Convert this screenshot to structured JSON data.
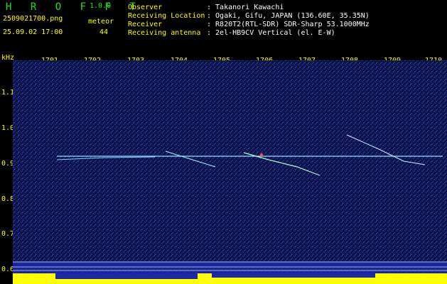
{
  "app": {
    "name": "H R O F F T",
    "version": "1.0.0"
  },
  "file": {
    "name": "2509021700.png",
    "datetime": "25.09.02 17:00"
  },
  "meteor": {
    "label": "meteor",
    "count": "44"
  },
  "info": [
    {
      "label": "Observer",
      "value": ": Takanori Kawachi"
    },
    {
      "label": "Receiving Location",
      "value": ": Ogaki, Gifu, JAPAN (136.60E, 35.35N)"
    },
    {
      "label": "Receiver",
      "value": ": R820T2(RTL-SDR) SDR-Sharp 53.1000MHz"
    },
    {
      "label": "Receiving antenna",
      "value": ": 2el-HB9CV Vertical (el. E-W)"
    }
  ],
  "axis": {
    "unit": "kHz",
    "x_ticks": [
      "1701",
      "1702",
      "1703",
      "1704",
      "1705",
      "1706",
      "1707",
      "1708",
      "1709",
      "1710"
    ],
    "y_ticks": [
      "1.1",
      "1.0",
      "0.9",
      "0.8",
      "0.7",
      "0.6"
    ]
  },
  "colors": {
    "background": "#000000",
    "label": "#ffff00",
    "title": "#22dd22",
    "noise": "#1a2a9a",
    "trace": "#8fe6ff"
  }
}
